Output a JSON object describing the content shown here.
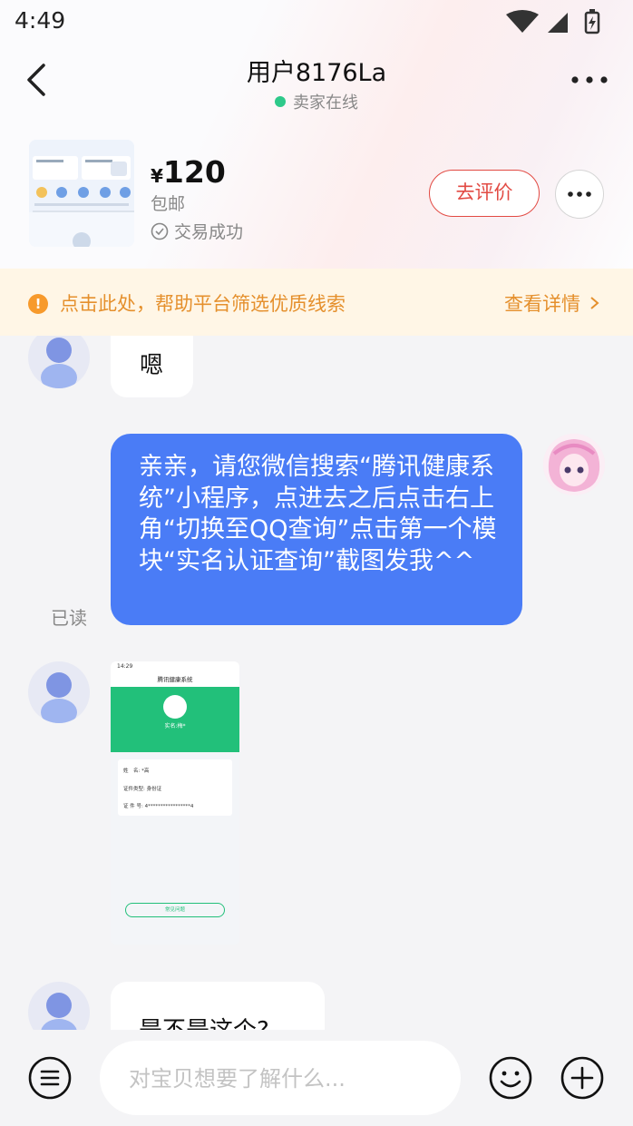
{
  "status_bar": {
    "time": "4:49"
  },
  "nav": {
    "title": "用户8176La",
    "status": "卖家在线",
    "accent_online": "#2ec98a"
  },
  "product": {
    "currency": "¥",
    "price": "120",
    "shipping": "包邮",
    "deal_status": "交易成功",
    "review_label": "去评价"
  },
  "notice": {
    "text": "点击此处，帮助平台筛选优质线索",
    "link": "查看详情"
  },
  "messages": {
    "m1_text": "嗯",
    "m2_text": "亲亲，请您微信搜索“腾讯健康系统”小程序，点进去之后点击右上角“切换至QQ查询”点击第一个模块“实名认证查询”截图发我^^",
    "m2_read": "已读",
    "m3_screenshot": {
      "time": "14:29",
      "title": "腾讯健康系统",
      "name_prefix": "实名:",
      "name": "梅*",
      "fields": [
        {
          "label": "姓　名:",
          "value": "*高"
        },
        {
          "label": "证件类型:",
          "value": "身份证"
        },
        {
          "label": "证 件 号:",
          "value": "4*****************4"
        }
      ],
      "button": "常见问题"
    },
    "m4_text": "是不是这个?"
  },
  "input": {
    "placeholder": "对宝贝想要了解什么..."
  },
  "colors": {
    "accent_red": "#e24a43",
    "bubble_blue": "#4a7cf6",
    "notice_orange": "#e5902d"
  },
  "icons": [
    "back-arrow-icon",
    "more-dots-icon",
    "check-circle-icon",
    "warning-icon",
    "chevron-right-icon",
    "menu-icon",
    "emoji-icon",
    "plus-icon"
  ]
}
